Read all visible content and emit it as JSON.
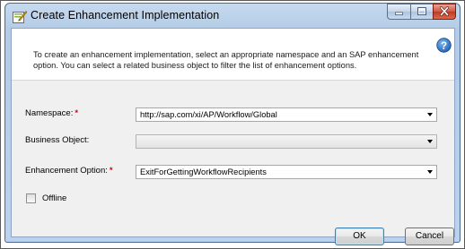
{
  "window": {
    "title": "Create Enhancement Implementation",
    "controls": [
      "minimize-icon",
      "maximize-icon",
      "close-icon"
    ]
  },
  "header": {
    "description": "To create an enhancement implementation, select an appropriate namespace and an SAP enhancement option. You can select a related business object to filter the list of enhancement options.",
    "help_icon": "help-icon"
  },
  "form": {
    "required_marker": "*",
    "namespace": {
      "label": "Namespace:",
      "required": true,
      "value": "http://sap.com/xi/AP/Workflow/Global"
    },
    "business_object": {
      "label": "Business Object:",
      "required": false,
      "value": ""
    },
    "enhancement_option": {
      "label": "Enhancement Option:",
      "required": true,
      "value": "ExitForGettingWorkflowRecipients"
    },
    "offline": {
      "label": "Offline",
      "checked": false
    }
  },
  "buttons": {
    "ok": "OK",
    "cancel": "Cancel"
  },
  "colors": {
    "required": "#e0000e",
    "help": "#2a73c9",
    "close_button": "#c8452e"
  }
}
